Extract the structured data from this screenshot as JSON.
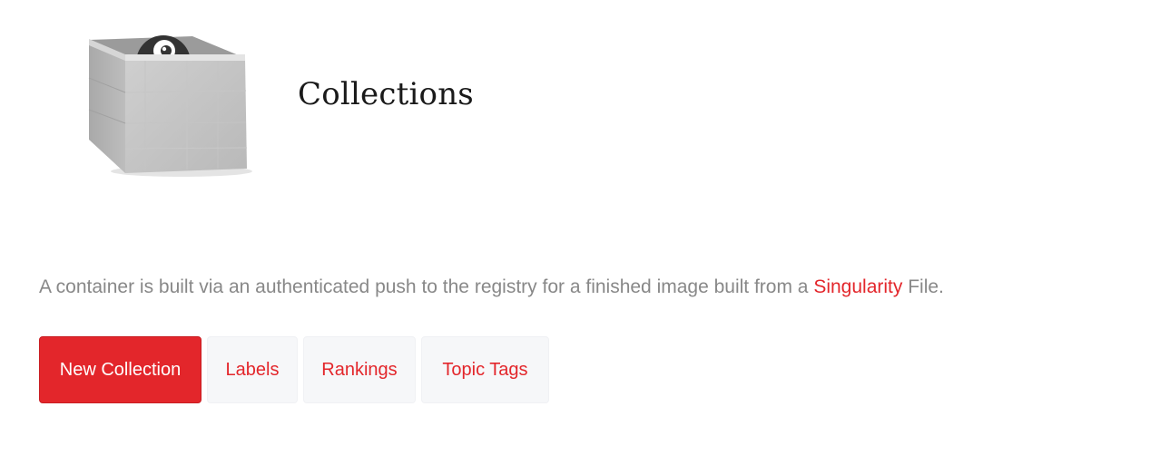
{
  "header": {
    "title": "Collections",
    "logo_icon": "container-box-icon"
  },
  "description": {
    "text_before": "A container is built via an authenticated push to the registry for a finished image built from a ",
    "link_text": "Singularity",
    "text_after": " File."
  },
  "actions": {
    "new_collection": "New Collection",
    "labels": "Labels",
    "rankings": "Rankings",
    "topic_tags": "Topic Tags"
  },
  "colors": {
    "accent": "#e3262b",
    "muted_text": "#888888",
    "secondary_button_bg": "#f6f7f9"
  }
}
